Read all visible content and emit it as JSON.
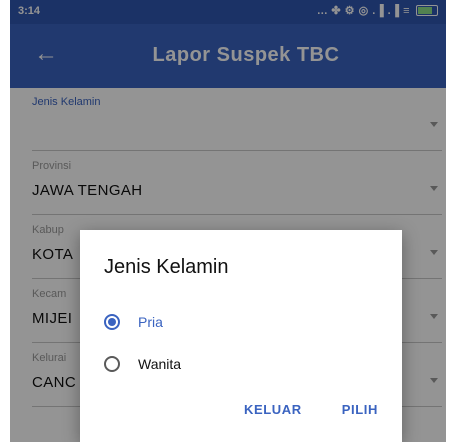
{
  "status_bar": {
    "time": "3:14",
    "indicators": "... ✤ ⚙ ◎ .▐ .▐ ≡"
  },
  "app_bar": {
    "back_icon": "←",
    "title": "Lapor Suspek TBC",
    "color": "#3a63c0"
  },
  "form": {
    "fields": [
      {
        "label": "Jenis Kelamin",
        "value": ""
      },
      {
        "label": "Provinsi",
        "value": "JAWA TENGAH"
      },
      {
        "label": "Kabup",
        "value": "KOTA"
      },
      {
        "label": "Kecam",
        "value": "MIJEI"
      },
      {
        "label": "Kelurai",
        "value": "CANC"
      }
    ]
  },
  "dialog": {
    "title": "Jenis Kelamin",
    "options": [
      {
        "label": "Pria",
        "selected": true
      },
      {
        "label": "Wanita",
        "selected": false
      }
    ],
    "cancel_label": "KELUAR",
    "confirm_label": "PILIH"
  }
}
